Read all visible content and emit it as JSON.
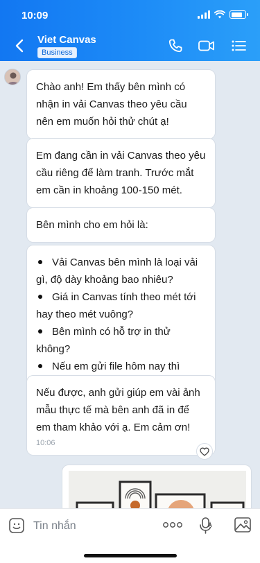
{
  "status_bar": {
    "time": "10:09",
    "battery_level": 0.8
  },
  "header": {
    "title": "Viet Canvas",
    "badge": "Business",
    "back_icon": "chevron-left-icon",
    "actions": [
      "phone-icon",
      "video-call-icon",
      "menu-list-icon"
    ]
  },
  "messages": [
    {
      "text": "Chào anh! Em thấy bên mình có nhận in vải Canvas theo yêu cầu nên em muốn hỏi thử chút ạ!"
    },
    {
      "text": "Em đang cần in vải Canvas theo yêu cầu riêng để làm tranh. Trước mắt em cần in khoảng 100-150 mét."
    },
    {
      "text": "Bên mình cho em hỏi là:"
    },
    {
      "items": [
        "Vải Canvas bên mình là loại vải gì, độ dày khoảng bao nhiêu?",
        "Giá in Canvas tính theo mét tới hay theo mét vuông?",
        "Bên mình có hỗ trợ in thử không?",
        "Nếu em gửi file hôm nay thì khoảng bao lâu có hàng?"
      ]
    },
    {
      "text": "Nếu được, anh gửi giúp em vài ảnh mẫu thực tế mà bên anh đã in để em tham khảo với ạ. Em cảm ơn!",
      "time": "10:06"
    }
  ],
  "input": {
    "placeholder": "Tin nhắn"
  },
  "colors": {
    "header_start": "#1277f2",
    "header_end": "#2b9ff9",
    "chat_bg": "#e2e9f1",
    "bubble": "#ffffff"
  }
}
